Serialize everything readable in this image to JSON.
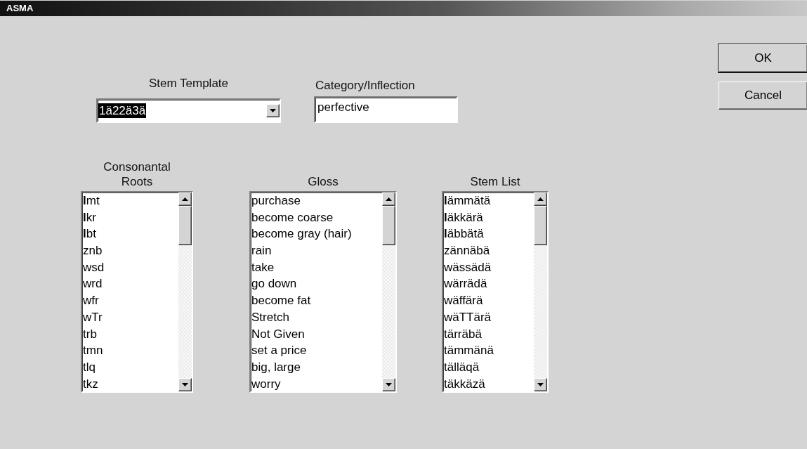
{
  "window": {
    "title": "ASMA"
  },
  "stem_template": {
    "label": "Stem Template",
    "value": "1ä22ä3ä",
    "value_highlighted": true
  },
  "category_inflection": {
    "label": "Category/Inflection",
    "value": "perfective"
  },
  "buttons": [
    {
      "label": "OK",
      "default": true
    },
    {
      "label": "Cancel",
      "default": false
    }
  ],
  "lists": [
    {
      "label": "Consonantal Roots",
      "items": [
        "**l**mt",
        "**l**kr",
        "**l**bt",
        "znb",
        "wsd",
        "wrd",
        "wfr",
        "wTr",
        "trb",
        "tmn",
        "tlq",
        "tkz"
      ]
    },
    {
      "label": "Gloss",
      "items": [
        "purchase",
        "become coarse",
        "become gray (hair)",
        "rain",
        "take",
        "go down",
        "become fat",
        "Stretch",
        "Not Given",
        "set a price",
        "big, large",
        "worry"
      ]
    },
    {
      "label": "Stem List",
      "items": [
        "**l**ämmätä",
        "**l**äkkärä",
        "**l**äbbätä",
        "zännäbä",
        "wässädä",
        "wärrädä",
        "wäffärä",
        "wäTTärä",
        "tärräbä",
        "tämmänä",
        "tälläqä",
        "täkkäzä"
      ]
    }
  ]
}
